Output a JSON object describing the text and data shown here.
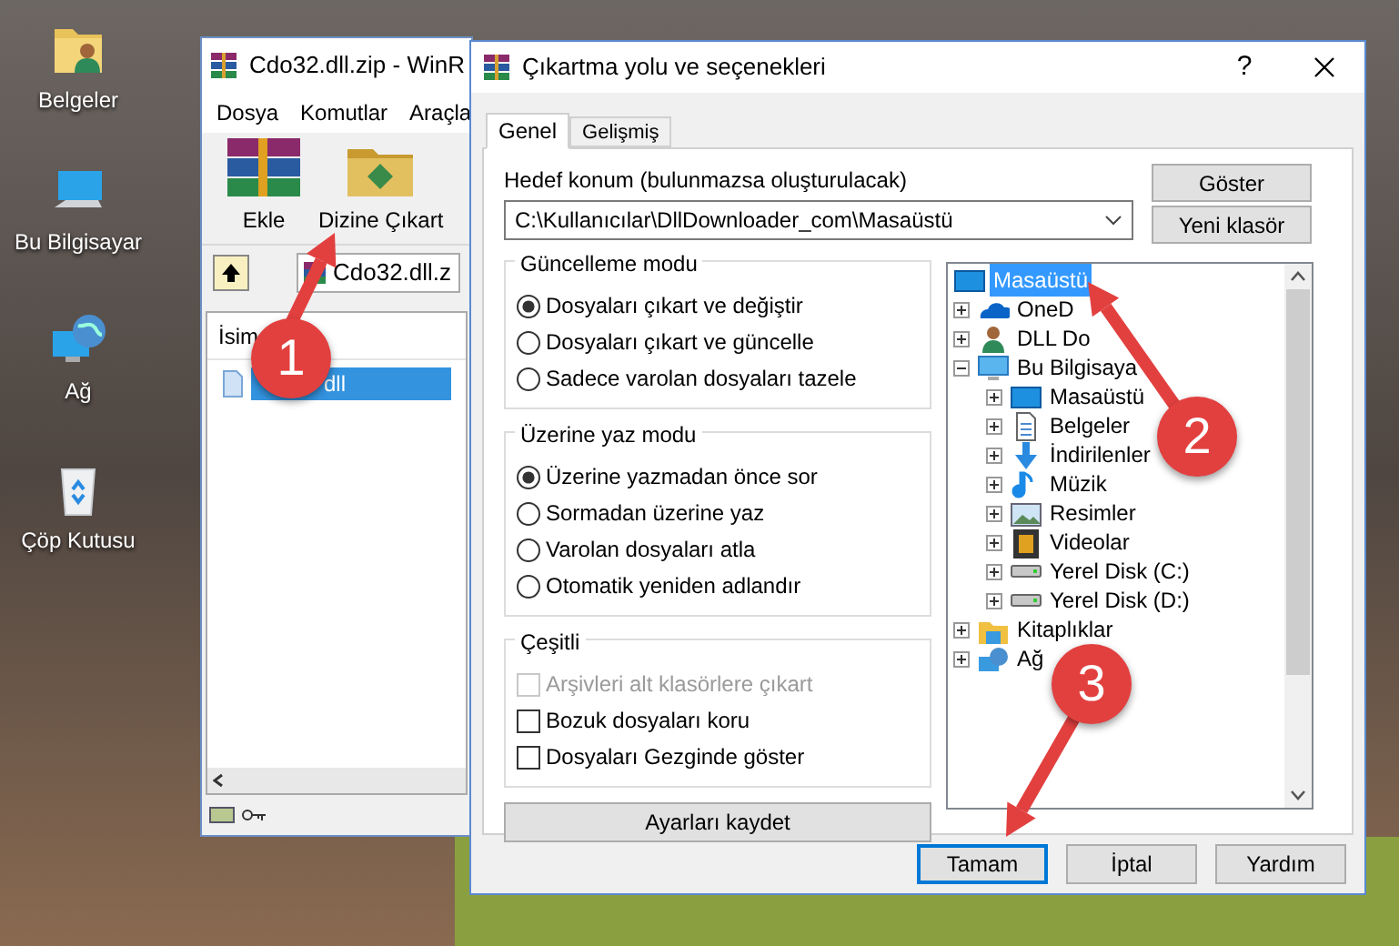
{
  "desktop_icons": [
    {
      "label": "Belgeler",
      "kind": "documents"
    },
    {
      "label": "Bu Bilgisayar",
      "kind": "computer"
    },
    {
      "label": "Ağ",
      "kind": "network"
    },
    {
      "label": "Çöp Kutusu",
      "kind": "recycle"
    }
  ],
  "archive_window": {
    "title": "Cdo32.dll.zip - WinR",
    "menu": [
      "Dosya",
      "Komutlar",
      "Araçla"
    ],
    "toolbar": [
      {
        "label": "Ekle",
        "kind": "add"
      },
      {
        "label": "Dizine Çıkart",
        "kind": "extract"
      }
    ],
    "path": "Cdo32.dll.z",
    "column": "İsim",
    "files": [
      {
        "name": "dll",
        "selected": true
      }
    ]
  },
  "dialog": {
    "title": "Çıkartma yolu ve seçenekleri",
    "help": "?",
    "tabs": [
      {
        "label": "Genel",
        "selected": true
      },
      {
        "label": "Gelişmiş",
        "selected": false
      }
    ],
    "target_label": "Hedef konum (bulunmazsa oluşturulacak)",
    "target_path": "C:\\Kullanıcılar\\DllDownloader_com\\Masaüstü",
    "side_buttons": [
      "Göster",
      "Yeni klasör"
    ],
    "groups": [
      {
        "title": "Güncelleme modu",
        "kind": "radio",
        "options": [
          {
            "label": "Dosyaları çıkart ve değiştir",
            "selected": true
          },
          {
            "label": "Dosyaları çıkart ve güncelle",
            "selected": false
          },
          {
            "label": "Sadece varolan dosyaları tazele",
            "selected": false
          }
        ]
      },
      {
        "title": "Üzerine yaz modu",
        "kind": "radio",
        "options": [
          {
            "label": "Üzerine yazmadan önce sor",
            "selected": true
          },
          {
            "label": "Sormadan üzerine yaz",
            "selected": false
          },
          {
            "label": "Varolan dosyaları atla",
            "selected": false
          },
          {
            "label": "Otomatik yeniden adlandır",
            "selected": false
          }
        ]
      },
      {
        "title": "Çeşitli",
        "kind": "checkbox",
        "options": [
          {
            "label": "Arşivleri alt klasörlere çıkart",
            "checked": false,
            "disabled": true
          },
          {
            "label": "Bozuk dosyaları koru",
            "checked": false,
            "disabled": false
          },
          {
            "label": "Dosyaları Gezginde göster",
            "checked": false,
            "disabled": false
          }
        ]
      }
    ],
    "save_button": "Ayarları kaydet",
    "tree": [
      {
        "label": "Masaüstü",
        "kind": "desktop",
        "selected": true,
        "children": [
          {
            "label": "OneD",
            "kind": "cloud",
            "selected": false,
            "expanded": false
          },
          {
            "label": "DLL Do",
            "kind": "user",
            "selected": false,
            "expanded": false
          },
          {
            "label": "Bu Bilgisaya",
            "kind": "computer",
            "selected": false,
            "expanded": true,
            "children": [
              {
                "label": "Masaüstü",
                "kind": "desktop",
                "selected": false,
                "expanded": false
              },
              {
                "label": "Belgeler",
                "kind": "document",
                "selected": false,
                "expanded": false
              },
              {
                "label": "İndirilenler",
                "kind": "download",
                "selected": false,
                "expanded": false
              },
              {
                "label": "Müzik",
                "kind": "music",
                "selected": false,
                "expanded": false
              },
              {
                "label": "Resimler",
                "kind": "picture",
                "selected": false,
                "expanded": false
              },
              {
                "label": "Videolar",
                "kind": "video",
                "selected": false,
                "expanded": false
              },
              {
                "label": "Yerel Disk (C:)",
                "kind": "drive",
                "selected": false,
                "expanded": false
              },
              {
                "label": "Yerel Disk (D:)",
                "kind": "drive",
                "selected": false,
                "expanded": false
              }
            ]
          },
          {
            "label": "Kitaplıklar",
            "kind": "folder",
            "selected": false,
            "expanded": false
          },
          {
            "label": "Ağ",
            "kind": "network",
            "selected": false,
            "expanded": false
          }
        ]
      }
    ],
    "footer_buttons": [
      {
        "label": "Tamam",
        "focused": true
      },
      {
        "label": "İptal",
        "focused": false
      },
      {
        "label": "Yardım",
        "focused": false
      }
    ]
  },
  "steps": [
    {
      "number": "1"
    },
    {
      "number": "2"
    },
    {
      "number": "3"
    }
  ]
}
